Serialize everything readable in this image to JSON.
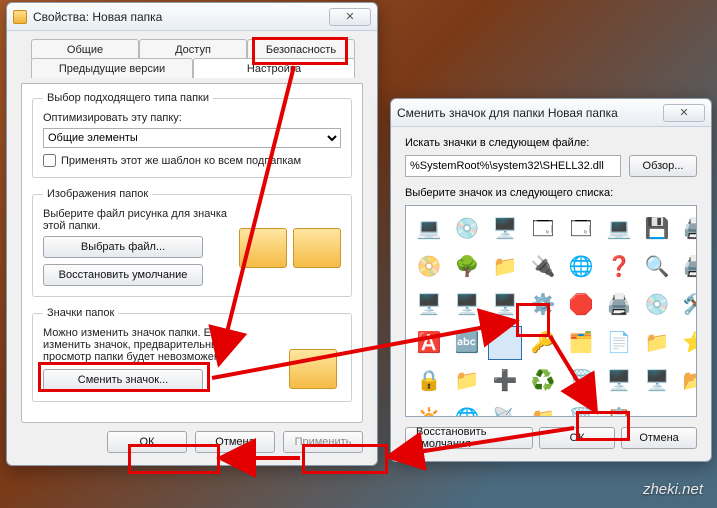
{
  "watermark": "zheki.net",
  "win1": {
    "title": "Свойства: Новая папка",
    "tabs": {
      "general": "Общие",
      "sharing": "Доступ",
      "security": "Безопасность",
      "previous": "Предыдущие версии",
      "customize": "Настройка"
    },
    "group_type": {
      "legend": "Выбор подходящего типа папки",
      "optimize": "Оптимизировать эту папку:",
      "combo_value": "Общие элементы",
      "apply_chk": "Применять этот же шаблон ко всем подпапкам"
    },
    "group_images": {
      "legend": "Изображения папок",
      "hint": "Выберите файл рисунка для значка этой папки.",
      "choose_btn": "Выбрать файл...",
      "restore_btn": "Восстановить умолчание"
    },
    "group_icons": {
      "legend": "Значки папок",
      "hint": "Можно изменить значок папки. Если изменить значок, предварительный просмотр папки будет невозможен.",
      "change_btn": "Сменить значок..."
    },
    "buttons": {
      "ok": "ОК",
      "cancel": "Отмена",
      "apply": "Применить"
    }
  },
  "win2": {
    "title": "Сменить значок для папки Новая папка",
    "search_label": "Искать значки в следующем файле:",
    "path_value": "%SystemRoot%\\system32\\SHELL32.dll",
    "browse_btn": "Обзор...",
    "list_label": "Выберите значок из следующего списка:",
    "buttons": {
      "restore": "Восстановить умолчания",
      "ok": "ОК",
      "cancel": "Отмена"
    },
    "icons": [
      "💻",
      "💿",
      "🖥️",
      "🗔",
      "🗔",
      "💻",
      "💾",
      "🖨️",
      "📀",
      "🌳",
      "📁",
      "🔌",
      "🌐",
      "❓",
      "🔍",
      "🖨️",
      "🖥️",
      "🖥️",
      "🖥️",
      "⚙️",
      "🛑",
      "🖨️",
      "💿",
      "🛠️",
      "🅰️",
      "🔤",
      "",
      "🔑",
      "🗂️",
      "📄",
      "📁",
      "⭐",
      "🔒",
      "📁",
      "➕",
      "♻️",
      "🗑️",
      "🖥️",
      "🖥️",
      "📂",
      "🔆",
      "🌐",
      "📡",
      "📁",
      "🗑️",
      "📋"
    ]
  }
}
